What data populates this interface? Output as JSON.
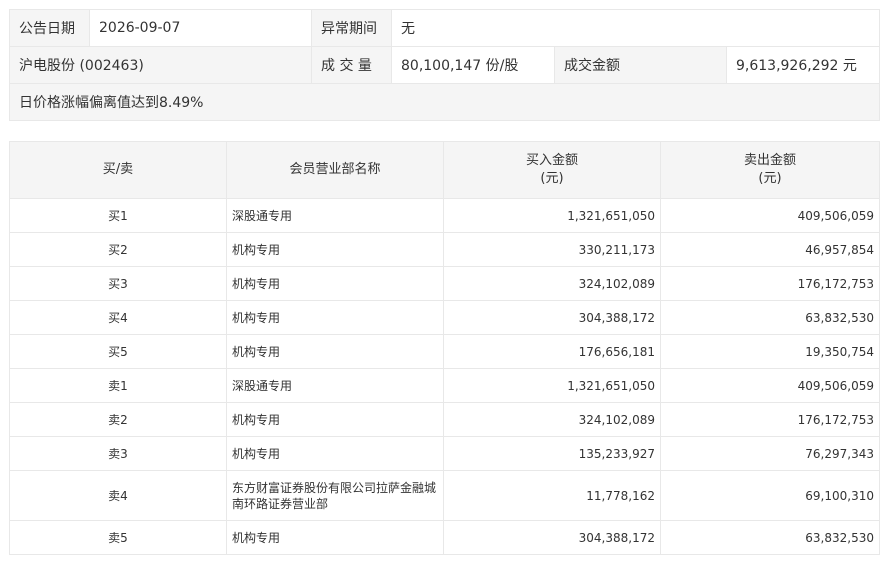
{
  "info": {
    "announce_label": "公告日期",
    "announce_value": "2026-09-07",
    "period_label": "异常期间",
    "period_value": "无",
    "stock_name": "沪电股份 (002463)",
    "volume_label": "成 交 量",
    "volume_value": "80,100,147 份/股",
    "amount_label": "成交金额",
    "amount_value": "9,613,926,292 元",
    "reason": "日价格涨幅偏离值达到8.49%"
  },
  "trade": {
    "headers": {
      "side": "买/卖",
      "dept": "会员营业部名称",
      "buy_line1": "买入金额",
      "buy_line2": "(元)",
      "sell_line1": "卖出金额",
      "sell_line2": "(元)"
    },
    "rows": [
      {
        "side": "买1",
        "dept": "深股通专用",
        "buy": "1,321,651,050",
        "sell": "409,506,059"
      },
      {
        "side": "买2",
        "dept": "机构专用",
        "buy": "330,211,173",
        "sell": "46,957,854"
      },
      {
        "side": "买3",
        "dept": "机构专用",
        "buy": "324,102,089",
        "sell": "176,172,753"
      },
      {
        "side": "买4",
        "dept": "机构专用",
        "buy": "304,388,172",
        "sell": "63,832,530"
      },
      {
        "side": "买5",
        "dept": "机构专用",
        "buy": "176,656,181",
        "sell": "19,350,754"
      },
      {
        "side": "卖1",
        "dept": "深股通专用",
        "buy": "1,321,651,050",
        "sell": "409,506,059"
      },
      {
        "side": "卖2",
        "dept": "机构专用",
        "buy": "324,102,089",
        "sell": "176,172,753"
      },
      {
        "side": "卖3",
        "dept": "机构专用",
        "buy": "135,233,927",
        "sell": "76,297,343"
      },
      {
        "side": "卖4",
        "dept": "东方财富证券股份有限公司拉萨金融城南环路证券营业部",
        "buy": "11,778,162",
        "sell": "69,100,310"
      },
      {
        "side": "卖5",
        "dept": "机构专用",
        "buy": "304,388,172",
        "sell": "63,832,530"
      }
    ]
  }
}
